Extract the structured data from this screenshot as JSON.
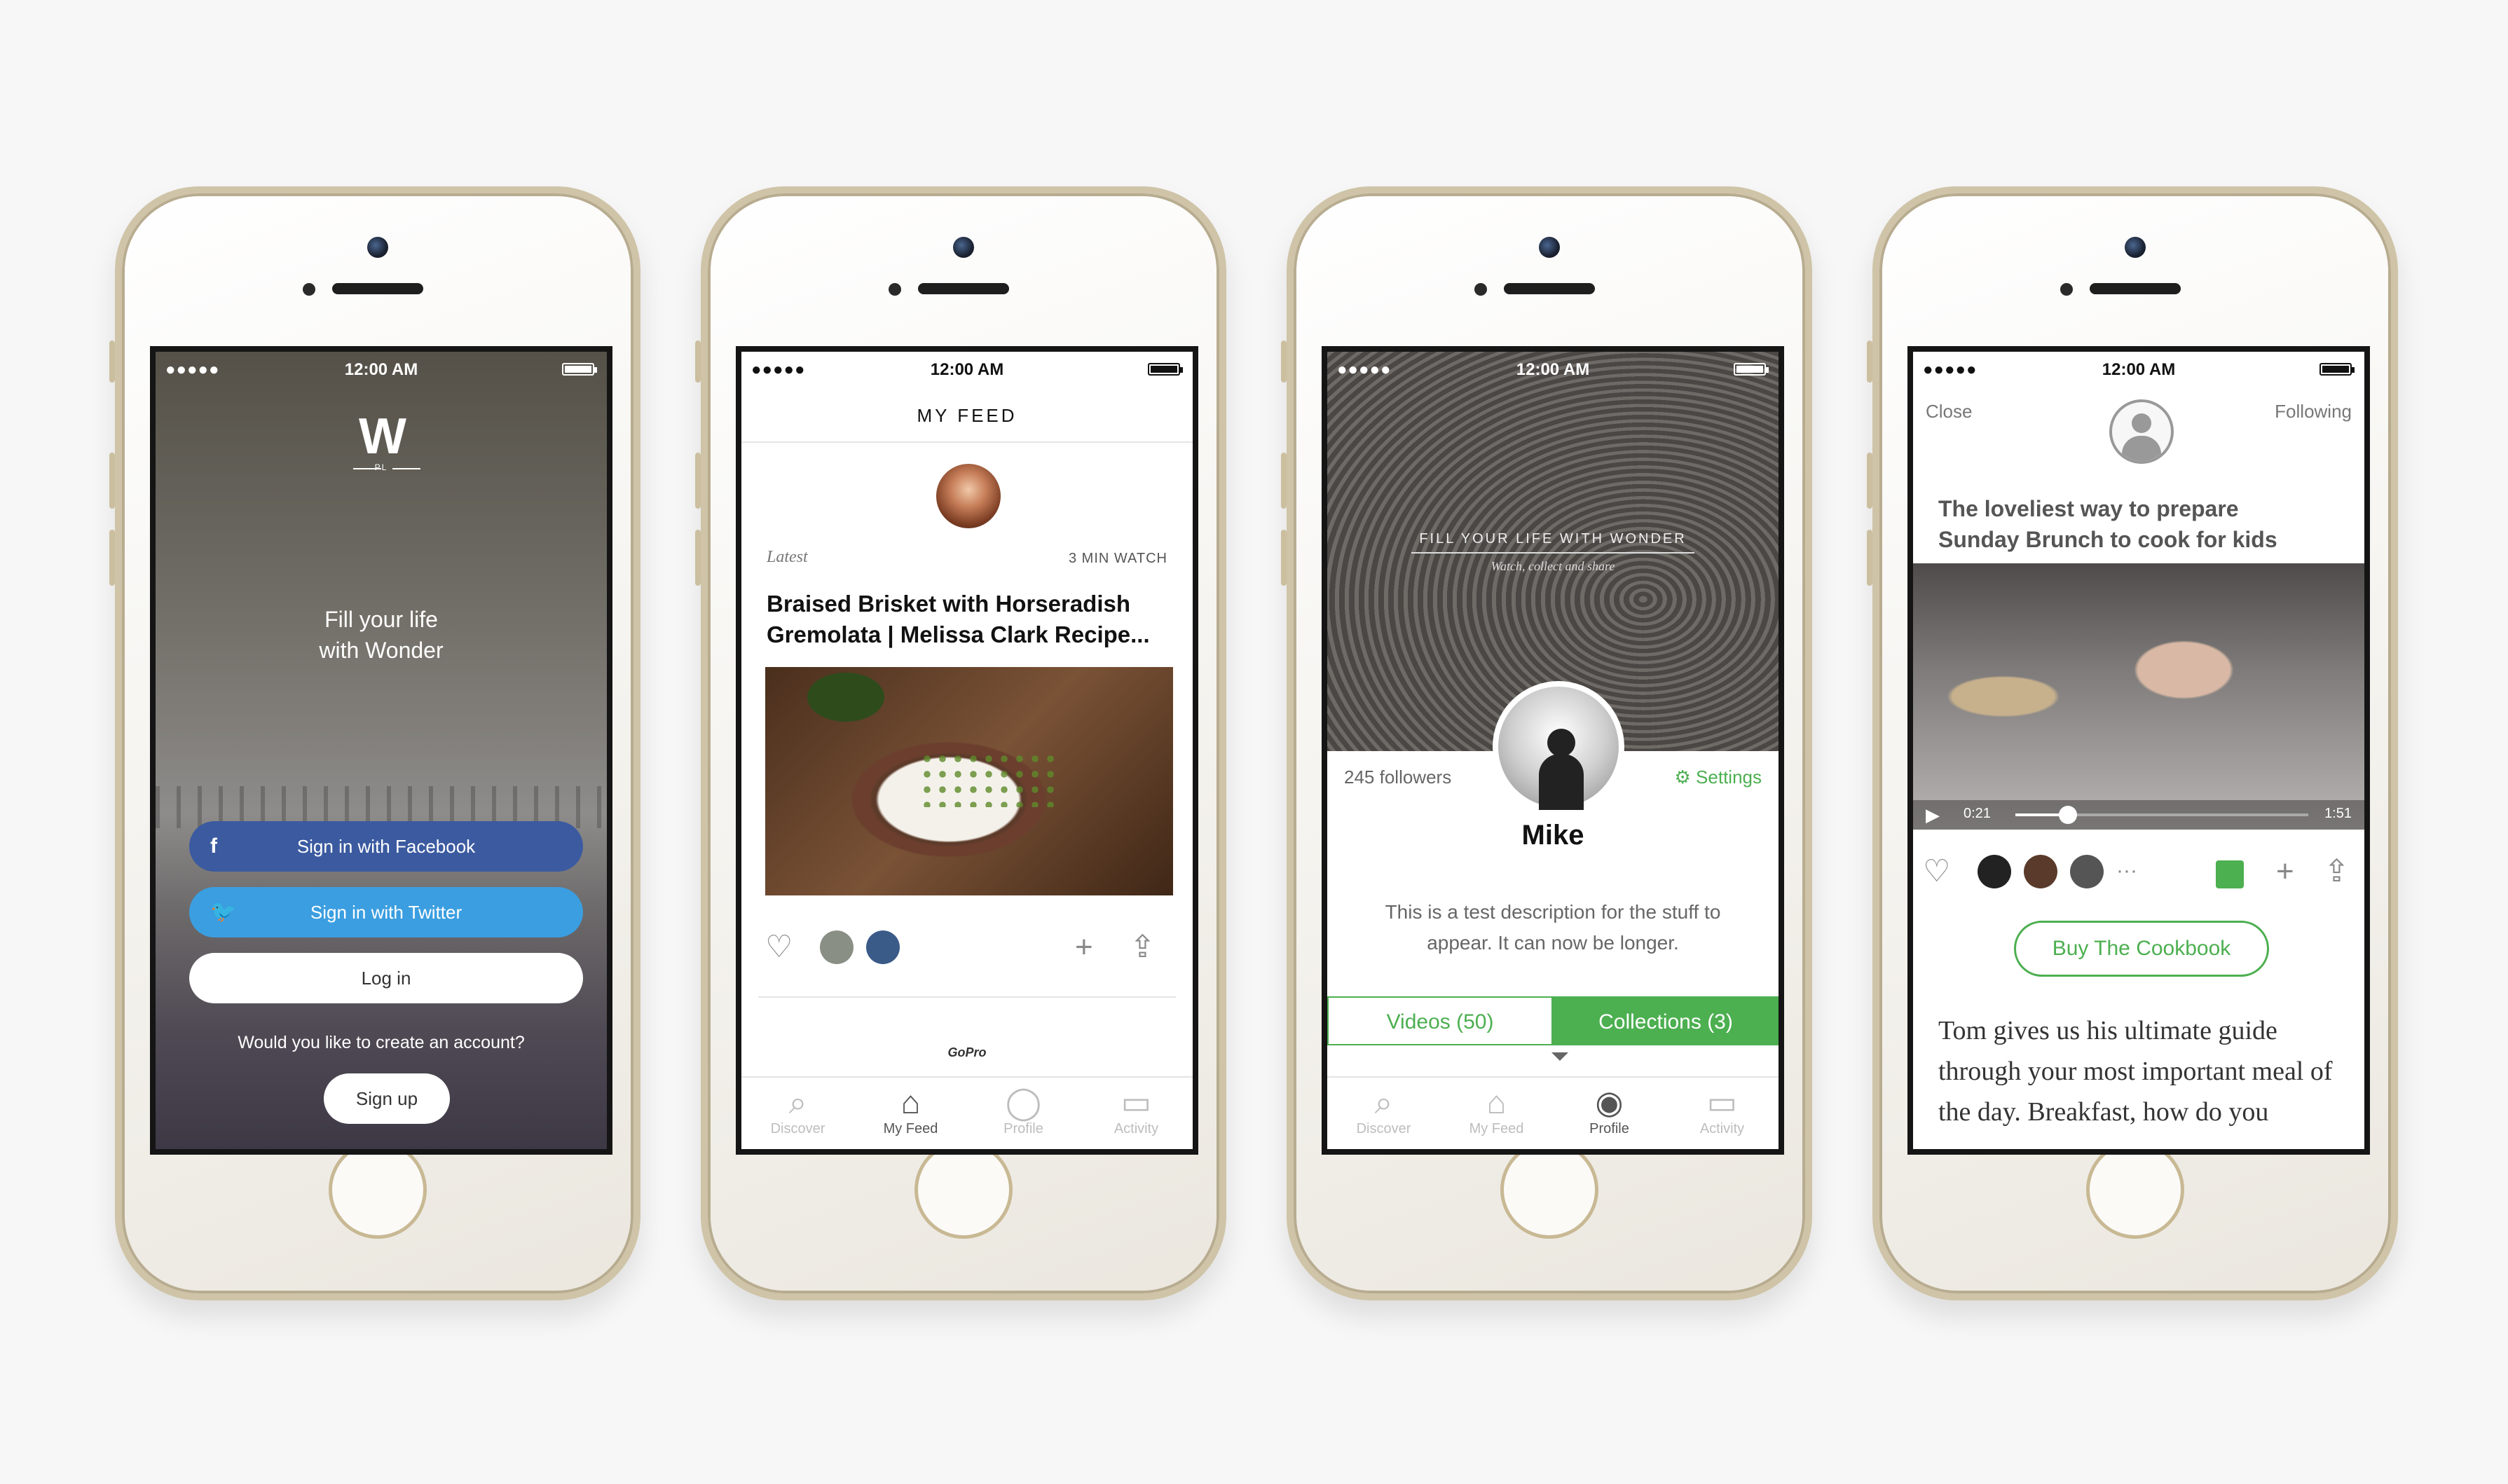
{
  "status_bar": {
    "signal": "●●●●●",
    "time": "12:00 AM"
  },
  "screen1": {
    "logo": "W",
    "logo_sub": "PL",
    "tagline_line1": "Fill your life",
    "tagline_line2": "with Wonder",
    "facebook_label": "Sign in with Facebook",
    "twitter_label": "Sign in with Twitter",
    "login_label": "Log in",
    "create_prompt": "Would you like to create an account?",
    "signup_label": "Sign up"
  },
  "screen2": {
    "nav_title": "MY FEED",
    "latest_label": "Latest",
    "duration": "3 MIN WATCH",
    "title_line1": "Braised Brisket with Horseradish",
    "title_line2": "Gremolata | Melissa Clark Recipe...",
    "sponsor": "GoPro"
  },
  "tabs": [
    {
      "label": "Discover",
      "icon": "search-icon"
    },
    {
      "label": "My Feed",
      "icon": "home-icon"
    },
    {
      "label": "Profile",
      "icon": "profile-icon"
    },
    {
      "label": "Activity",
      "icon": "chat-icon"
    }
  ],
  "screen3": {
    "hero_title": "FILL YOUR LIFE WITH WONDER",
    "hero_subtitle": "Watch, collect and share",
    "followers": "245 followers",
    "settings_label": "Settings",
    "name": "Mike",
    "description": "This is a test description for the stuff to appear. It can now be longer.",
    "videos_tab": "Videos (50)",
    "collections_tab": "Collections (3)"
  },
  "screen4": {
    "close_label": "Close",
    "following_label": "Following",
    "title_line1": "The loveliest way to prepare",
    "title_line2": "Sunday Brunch to cook for kids",
    "time_current": "0:21",
    "time_total": "1:51",
    "progress": 0.18,
    "more_label": "···",
    "buy_label": "Buy The Cookbook",
    "story": "Tom gives us his ultimate guide through your most important meal of the day. Breakfast, how do you"
  },
  "colors": {
    "accent_green": "#4caf50",
    "facebook_blue": "#3b5aa0",
    "twitter_blue": "#3b9ee0"
  }
}
